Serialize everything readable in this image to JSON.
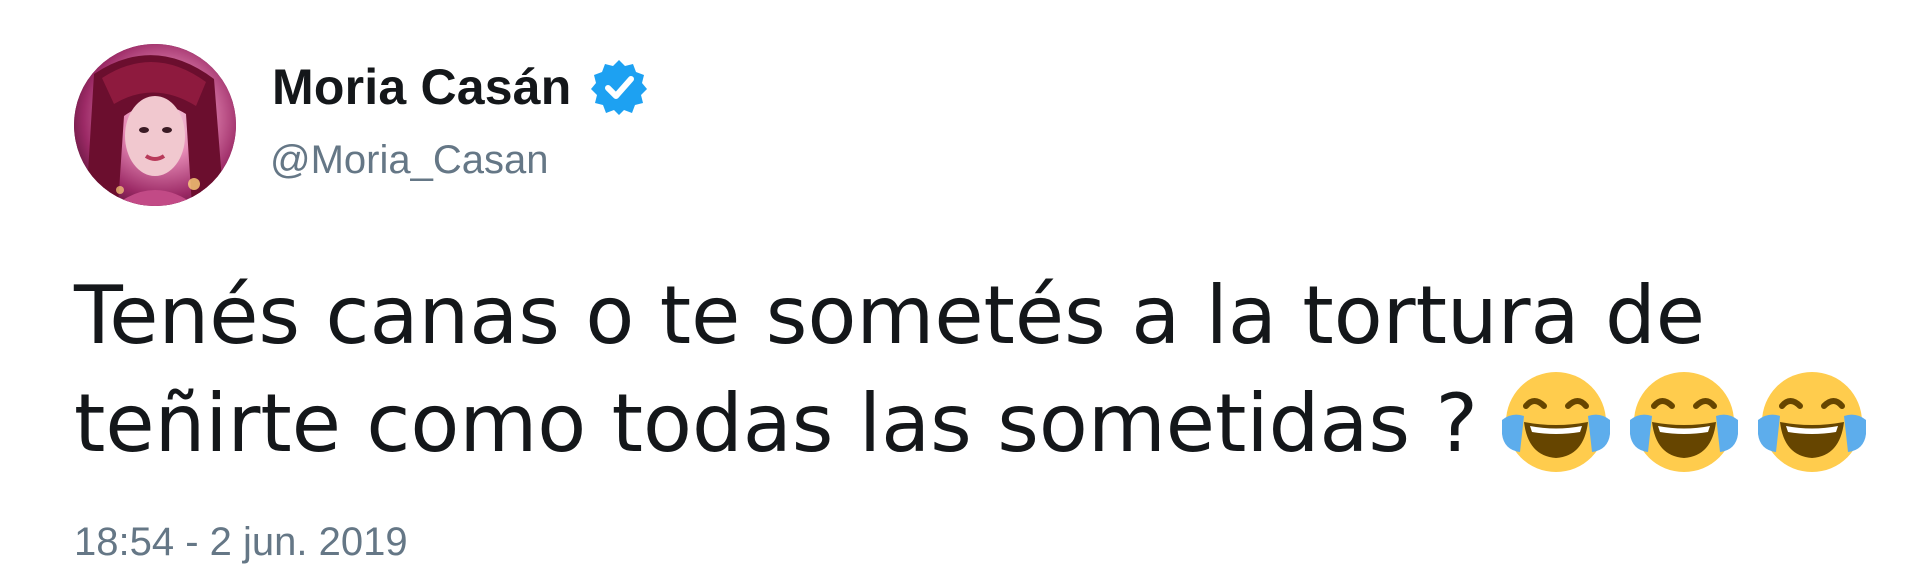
{
  "author": {
    "display_name": "Moria Casán",
    "handle": "@Moria_Casan",
    "verified": true,
    "verified_icon": "verified-badge-icon",
    "avatar_icon": "profile-avatar"
  },
  "tweet": {
    "text_line_1": "Tenés canas o te sometés a la tortura de",
    "text_line_2": "teñirte como todas las sometidas ?",
    "emojis": [
      "face-with-tears-of-joy",
      "face-with-tears-of-joy",
      "face-with-tears-of-joy"
    ],
    "timestamp": "18:54 - 2 jun. 2019"
  },
  "colors": {
    "text": "#14171a",
    "secondary": "#657786",
    "verified_blue": "#1da1f2",
    "emoji_yellow": "#ffcc4d",
    "tear_blue": "#5dadec"
  }
}
